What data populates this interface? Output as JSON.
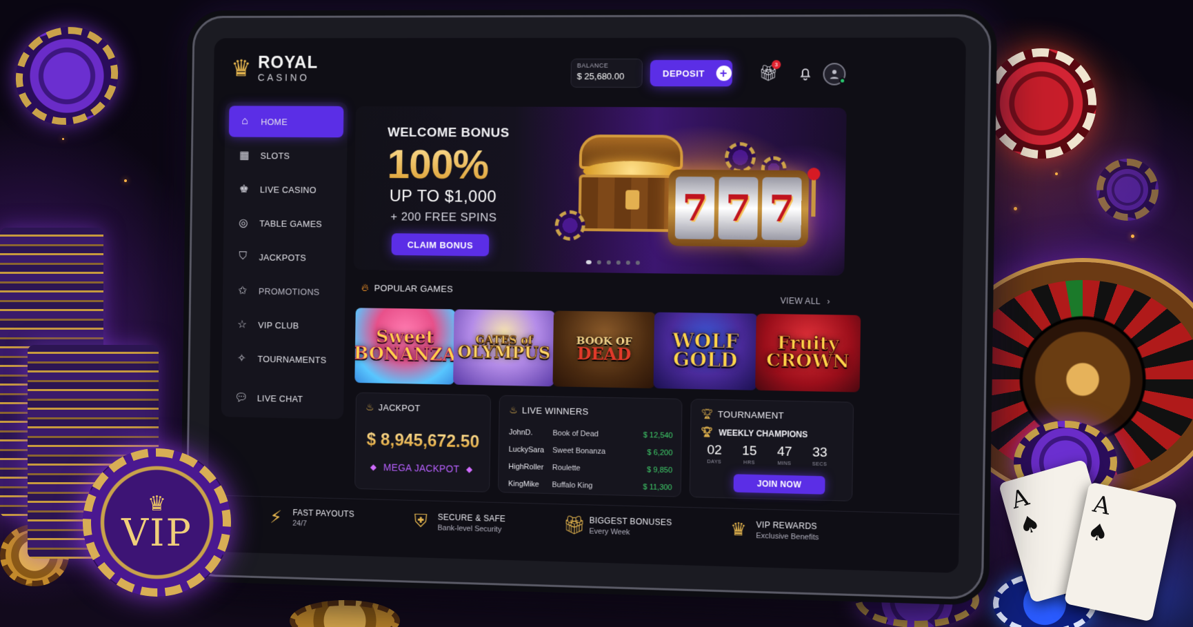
{
  "brand": {
    "name": "ROYAL",
    "tagline": "CASINO"
  },
  "header": {
    "balance_label": "BALANCE",
    "balance_value": "$ 25,680.00",
    "deposit_label": "DEPOSIT",
    "gift_badge": "3"
  },
  "sidebar": {
    "items": [
      {
        "label": "HOME",
        "icon": "home-icon",
        "active": true
      },
      {
        "label": "SLOTS",
        "icon": "slots-icon"
      },
      {
        "label": "LIVE CASINO",
        "icon": "live-casino-icon"
      },
      {
        "label": "TABLE GAMES",
        "icon": "table-games-icon"
      },
      {
        "label": "JACKPOTS",
        "icon": "jackpots-icon"
      },
      {
        "label": "PROMOTIONS",
        "icon": "promotions-icon"
      },
      {
        "label": "VIP CLUB",
        "icon": "vip-club-icon"
      },
      {
        "label": "TOURNAMENTS",
        "icon": "tournaments-icon"
      },
      {
        "label": "LIVE CHAT",
        "icon": "live-chat-icon"
      }
    ]
  },
  "hero": {
    "title": "WELCOME BONUS",
    "percent": "100%",
    "up_to": "UP TO $1,000",
    "spins": "+ 200 FREE SPINS",
    "cta": "CLAIM BONUS",
    "reel_symbols": [
      "7",
      "7",
      "7"
    ],
    "slide_count": 6,
    "active_slide": 0
  },
  "popular": {
    "title": "POPULAR GAMES",
    "view_all": "VIEW ALL",
    "games": [
      {
        "line1": "Sweet",
        "line2": "BONANZA"
      },
      {
        "line1": "GATES of",
        "line2": "OLYMPUS"
      },
      {
        "line1": "BOOK OF",
        "line2": "DEAD"
      },
      {
        "line1": "WOLF",
        "line2": "GOLD"
      },
      {
        "line1": "Fruity",
        "line2": "CROWN"
      }
    ]
  },
  "jackpot": {
    "title": "JACKPOT",
    "amount": "$ 8,945,672.50",
    "label": "MEGA JACKPOT"
  },
  "live_winners": {
    "title": "LIVE WINNERS",
    "rows": [
      {
        "name": "JohnD.",
        "game": "Book of Dead",
        "amount": "$ 12,540"
      },
      {
        "name": "LuckySara",
        "game": "Sweet Bonanza",
        "amount": "$ 6,200"
      },
      {
        "name": "HighRoller",
        "game": "Roulette",
        "amount": "$ 9,850"
      },
      {
        "name": "KingMike",
        "game": "Buffalo King",
        "amount": "$ 11,300"
      }
    ]
  },
  "tournament": {
    "title": "TOURNAMENT",
    "subtitle": "WEEKLY CHAMPIONS",
    "countdown": [
      {
        "value": "02",
        "label": "DAYS"
      },
      {
        "value": "15",
        "label": "HRS"
      },
      {
        "value": "47",
        "label": "MINS"
      },
      {
        "value": "33",
        "label": "SECS"
      }
    ],
    "cta": "JOIN NOW"
  },
  "features": [
    {
      "title": "FAST PAYOUTS",
      "sub": "24/7",
      "icon": "lightning-icon"
    },
    {
      "title": "SECURE & SAFE",
      "sub": "Bank-level Security",
      "icon": "shield-icon"
    },
    {
      "title": "BIGGEST BONUSES",
      "sub": "Every Week",
      "icon": "gift-icon"
    },
    {
      "title": "VIP REWARDS",
      "sub": "Exclusive Benefits",
      "icon": "crown-icon"
    }
  ],
  "vip_chip": {
    "text": "VIP"
  },
  "cards": [
    {
      "rank": "A",
      "suit": "♠"
    },
    {
      "rank": "A",
      "suit": "♠"
    }
  ],
  "colors": {
    "accent": "#5b2ee6",
    "gold": "#e3b44e",
    "win_green": "#3fcf6a",
    "mega_purple": "#b860ff"
  }
}
